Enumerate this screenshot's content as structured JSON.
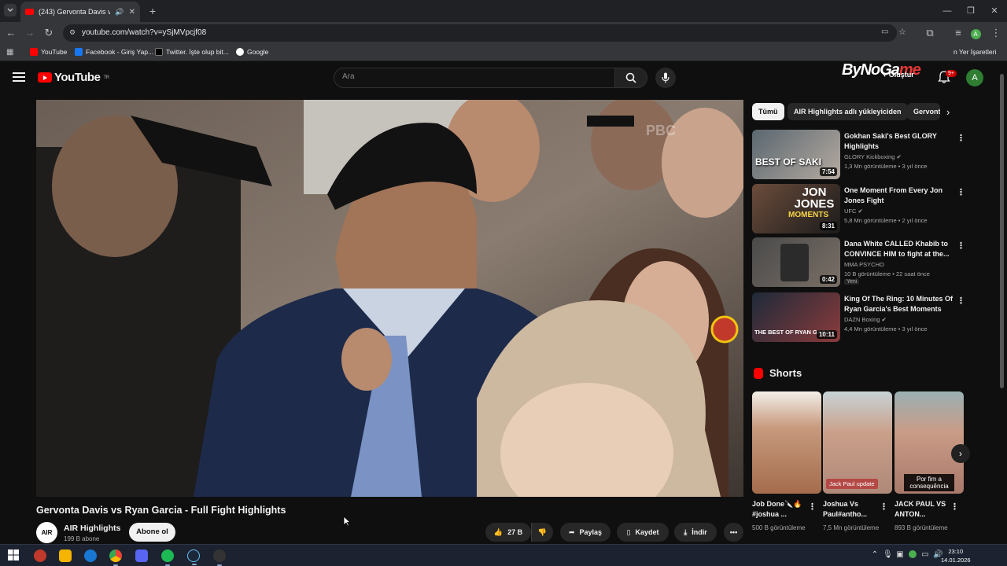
{
  "browser": {
    "tab_title": "(243) Gervonta Davis vs Ryan",
    "url": "youtube.com/watch?v=ySjMVpcjf08",
    "bookmarks": [
      "YouTube",
      "Facebook - Giriş Yap...",
      "Twitter. İşte olup bit...",
      "Google"
    ],
    "other_bookmarks_label": "n Yer İşaretleri"
  },
  "youtube": {
    "logo_text": "YouTube",
    "region": "TR",
    "search_placeholder": "Ara",
    "watermark_a": "ByNoGa",
    "watermark_b": "me",
    "create_label": "Oluştur",
    "notif_count": "9+",
    "avatar_letter": "A"
  },
  "video": {
    "title": "Gervonta Davis vs Ryan Garcia - Full Fight Highlights",
    "channel": "AIR Highlights",
    "channel_avatar": "AIR",
    "subscribers": "199 B abone",
    "subscribe_label": "Abone ol",
    "likes": "27 B",
    "share_label": "Paylaş",
    "save_label": "Kaydet",
    "download_label": "İndir",
    "overlay_logo": "PBC"
  },
  "chips": [
    "Tümü",
    "AIR Highlights adlı yükleyiciden",
    "Gervonta"
  ],
  "recommendations": [
    {
      "title": "Gokhan Saki's Best GLORY Highlights",
      "channel": "GLORY Kickboxing",
      "meta": "1,3 Mn görüntüleme • 3 yıl önce",
      "duration": "7:54",
      "thumb_text": "BEST OF SAKI",
      "new": ""
    },
    {
      "title": "One Moment From Every Jon Jones Fight",
      "channel": "UFC",
      "meta": "5,8 Mn görüntüleme • 2 yıl önce",
      "duration": "8:31",
      "thumb_text": "JON JONES",
      "thumb_text2": "MOMENTS",
      "new": ""
    },
    {
      "title": "Dana White CALLED Khabib to CONVINCE HIM to fight at the...",
      "channel": "MMA PSYCHO",
      "meta": "10 B görüntüleme • 22 saat önce",
      "duration": "0:42",
      "thumb_text": "",
      "new": "Yeni"
    },
    {
      "title": "King Of The Ring: 10 Minutes Of Ryan Garcia's Best Moments",
      "channel": "DAZN Boxing",
      "meta": "4,4 Mn görüntüleme • 3 yıl önce",
      "duration": "10:11",
      "thumb_text": "THE BEST OF RYAN GARC",
      "new": ""
    }
  ],
  "shorts": {
    "header": "Shorts",
    "items": [
      {
        "title": "Job Done🔪🔥 #joshua ...",
        "views": "500 B görüntüleme",
        "caption": ""
      },
      {
        "title": "Joshua Vs Paul#antho...",
        "views": "7,5 Mn görüntüleme",
        "caption": "Jack Paul update"
      },
      {
        "title": "JACK PAUL VS ANTON...",
        "views": "893 B görüntüleme",
        "caption": "Por fim a consequência"
      }
    ]
  },
  "taskbar": {
    "time": "23:10",
    "date": "14.01.2026"
  }
}
